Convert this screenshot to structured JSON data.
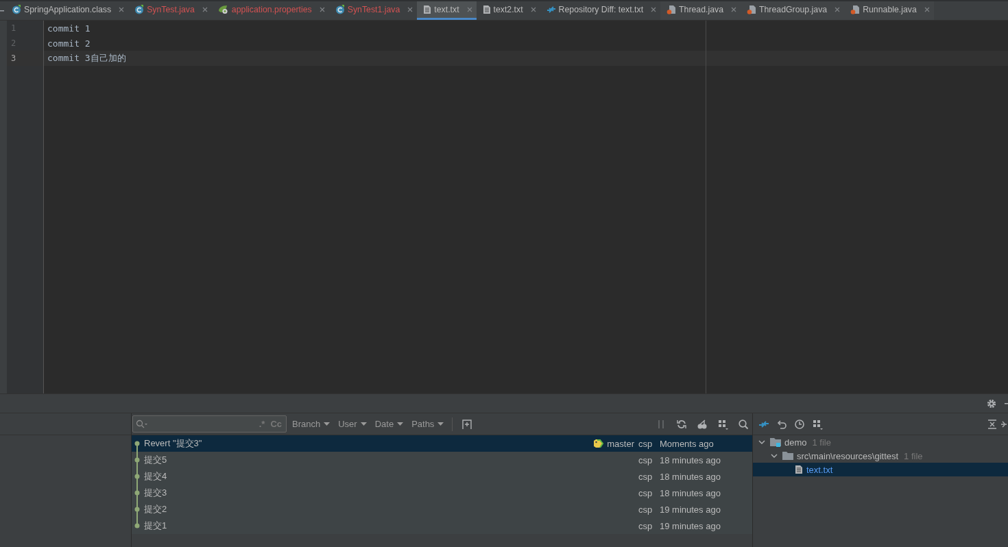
{
  "tabs": [
    {
      "label": "SpringApplication.class",
      "kind": "class",
      "modified": false,
      "selected": false
    },
    {
      "label": "SynTest.java",
      "kind": "class",
      "modified": true,
      "selected": false
    },
    {
      "label": "application.properties",
      "kind": "properties",
      "modified": true,
      "selected": false
    },
    {
      "label": "SynTest1.java",
      "kind": "class",
      "modified": true,
      "selected": false
    },
    {
      "label": "text.txt",
      "kind": "text",
      "modified": false,
      "selected": true
    },
    {
      "label": "text2.txt",
      "kind": "text",
      "modified": false,
      "selected": false
    },
    {
      "label": "Repository Diff: text.txt",
      "kind": "diff",
      "modified": false,
      "selected": false
    },
    {
      "label": "Thread.java",
      "kind": "library",
      "modified": false,
      "selected": false
    },
    {
      "label": "ThreadGroup.java",
      "kind": "library",
      "modified": false,
      "selected": false
    },
    {
      "label": "Runnable.java",
      "kind": "library",
      "modified": false,
      "selected": false
    }
  ],
  "editor": {
    "lines": [
      {
        "number": "1",
        "text": "commit 1",
        "current": false
      },
      {
        "number": "2",
        "text": "commit 2",
        "current": false
      },
      {
        "number": "3",
        "text": "commit 3自己加的",
        "current": true
      }
    ]
  },
  "vcs_log": {
    "search": {
      "regex_toggle": ".*",
      "case_toggle": "Cc"
    },
    "filters": [
      "Branch",
      "User",
      "Date",
      "Paths"
    ],
    "commits": [
      {
        "message": "Revert \"提交3\"",
        "tag": "master",
        "author": "csp",
        "date": "Moments ago",
        "selected": true
      },
      {
        "message": "提交5",
        "author": "csp",
        "date": "18 minutes ago",
        "selected": false
      },
      {
        "message": "提交4",
        "author": "csp",
        "date": "18 minutes ago",
        "selected": false
      },
      {
        "message": "提交3",
        "author": "csp",
        "date": "18 minutes ago",
        "selected": false
      },
      {
        "message": "提交2",
        "author": "csp",
        "date": "19 minutes ago",
        "selected": false
      },
      {
        "message": "提交1",
        "author": "csp",
        "date": "19 minutes ago",
        "selected": false
      }
    ]
  },
  "changes": {
    "tree": [
      {
        "label": "demo",
        "count": "1 file",
        "kind": "module",
        "expanded": true,
        "selected": false,
        "children": [
          {
            "label": "src\\main\\resources\\gittest",
            "count": "1 file",
            "kind": "folder",
            "expanded": true,
            "selected": false,
            "children": [
              {
                "label": "text.txt",
                "kind": "file",
                "selected": true
              }
            ]
          }
        ]
      }
    ]
  }
}
